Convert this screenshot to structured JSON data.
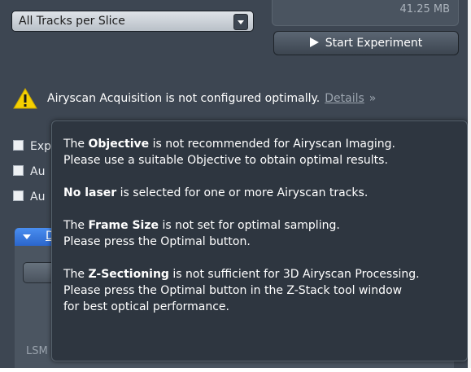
{
  "acquisition": {
    "track_mode": "All Tracks per Slice",
    "data_size": "41.25 MB",
    "start_button": "Start Experiment"
  },
  "warning": {
    "text": "Airyscan Acquisition is not configured optimally.",
    "details_link": "Details",
    "details_chevron": "»"
  },
  "checkboxes": [
    {
      "label": "Exp",
      "checked": false
    },
    {
      "label": "Au",
      "checked": false
    },
    {
      "label": "Au",
      "checked": false
    }
  ],
  "section": {
    "title": "D",
    "footer_label": "LSM"
  },
  "tooltip": {
    "objective_bold": "Objective",
    "objective_pre": "The ",
    "objective_post": " is not recommended for Airyscan Imaging.",
    "objective_line2": "Please use a suitable Objective to obtain optimal results.",
    "laser_bold": "No laser",
    "laser_post": " is selected for one or more Airyscan tracks.",
    "frame_pre": "The ",
    "frame_bold": "Frame Size",
    "frame_post": " is not set for optimal sampling.",
    "frame_line2": "Please press the Optimal button.",
    "z_pre": "The ",
    "z_bold": "Z-Sectioning",
    "z_post": " is not sufficient for 3D Airyscan Processing.",
    "z_line2": "Please press the Optimal button in the Z-Stack tool window",
    "z_line3": "for best optical performance."
  },
  "colors": {
    "panel_bg": "#3d4652",
    "tooltip_bg": "#2e3640",
    "warning_yellow": "#f5d000",
    "section_blue": "#2b66cc"
  },
  "icons": {
    "warning": "warning-triangle-icon",
    "play": "play-icon",
    "dropdown": "chevron-down-icon",
    "collapse": "collapse-triangle-icon"
  }
}
